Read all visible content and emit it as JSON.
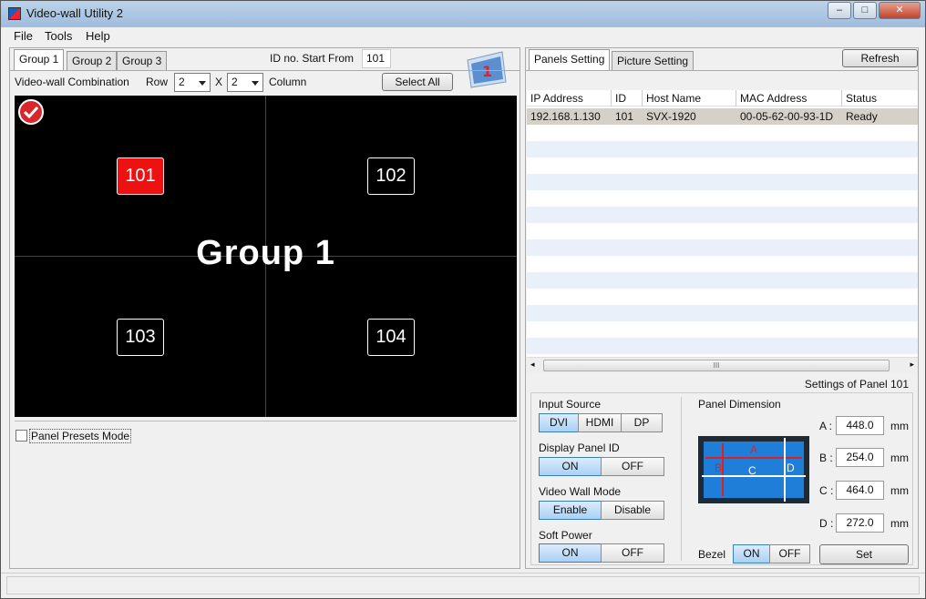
{
  "window": {
    "title": "Video-wall Utility 2",
    "minimize": "–",
    "maximize": "□",
    "close": "✕"
  },
  "menu": {
    "file": "File",
    "tools": "Tools",
    "help": "Help"
  },
  "left": {
    "tabs": [
      "Group 1",
      "Group 2",
      "Group 3"
    ],
    "id_start_label": "ID no. Start From",
    "id_start_value": "101",
    "combination_label": "Video-wall Combination",
    "row_label": "Row",
    "row_value": "2",
    "x_label": "X",
    "column_value": "2",
    "column_label": "Column",
    "select_all": "Select All",
    "group_title": "Group 1",
    "panels": [
      "101",
      "102",
      "103",
      "104"
    ],
    "presets_label": "Panel Presets Mode"
  },
  "right": {
    "tabs": [
      "Panels Setting",
      "Picture Setting"
    ],
    "refresh": "Refresh",
    "columns": [
      "IP Address",
      "ID",
      "Host Name",
      "MAC Address",
      "Status"
    ],
    "rows": [
      {
        "ip": "192.168.1.130",
        "id": "101",
        "host": "SVX-1920",
        "mac": "00-05-62-00-93-1D",
        "status": "Ready"
      }
    ],
    "scroll_grip": "III",
    "settings_title": "Settings of Panel 101",
    "input_source_label": "Input Source",
    "input_source_options": [
      "DVI",
      "HDMI",
      "DP"
    ],
    "display_id_label": "Display Panel ID",
    "display_id_options": [
      "ON",
      "OFF"
    ],
    "vw_mode_label": "Video Wall Mode",
    "vw_mode_options": [
      "Enable",
      "Disable"
    ],
    "soft_power_label": "Soft Power",
    "soft_power_options": [
      "ON",
      "OFF"
    ],
    "dimension_label": "Panel Dimension",
    "dims": [
      {
        "label": "A :",
        "value": "448.0",
        "unit": "mm"
      },
      {
        "label": "B :",
        "value": "254.0",
        "unit": "mm"
      },
      {
        "label": "C :",
        "value": "464.0",
        "unit": "mm"
      },
      {
        "label": "D :",
        "value": "272.0",
        "unit": "mm"
      }
    ],
    "diagram_letters": [
      "A",
      "B",
      "C",
      "D"
    ],
    "bezel_label": "Bezel",
    "bezel_options": [
      "ON",
      "OFF"
    ],
    "set": "Set"
  }
}
